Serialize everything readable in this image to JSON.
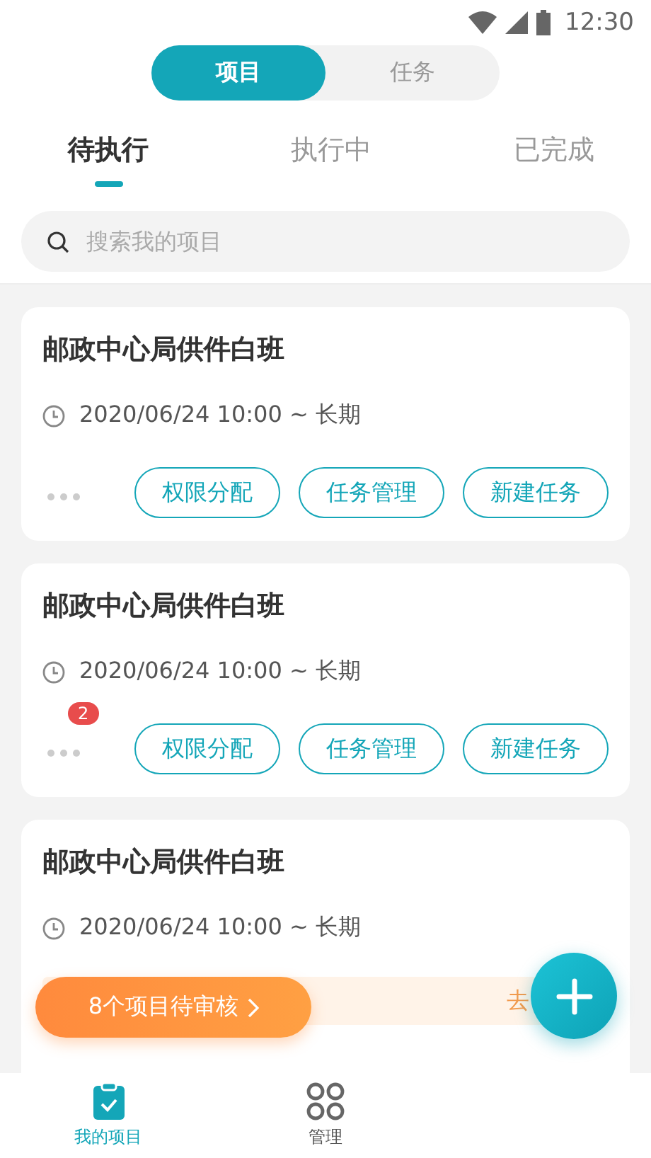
{
  "status_bar": {
    "time": "12:30"
  },
  "segments": [
    {
      "label": "项目",
      "selected": true
    },
    {
      "label": "任务",
      "selected": false
    }
  ],
  "tabs": [
    {
      "label": "待执行",
      "selected": true
    },
    {
      "label": "执行中",
      "selected": false
    },
    {
      "label": "已完成",
      "selected": false
    }
  ],
  "search": {
    "placeholder": "搜索我的项目"
  },
  "projects": [
    {
      "title": "邮政中心局供件白班",
      "time": "2020/06/24 10:00 ~ 长期",
      "actions": [
        "权限分配",
        "任务管理",
        "新建任务"
      ]
    },
    {
      "title": "邮政中心局供件白班",
      "time": "2020/06/24 10:00 ~ 长期",
      "badge": "2",
      "actions": [
        "权限分配",
        "任务管理",
        "新建任务"
      ]
    },
    {
      "title": "邮政中心局供件白班",
      "time": "2020/06/24 10:00 ~ 长期",
      "notice_link": "去"
    }
  ],
  "review_banner": {
    "label": "8个项目待审核"
  },
  "nav": [
    {
      "label": "我的项目",
      "selected": true,
      "kind": "clipboard"
    },
    {
      "label": "管理",
      "selected": false,
      "kind": "grid"
    }
  ]
}
